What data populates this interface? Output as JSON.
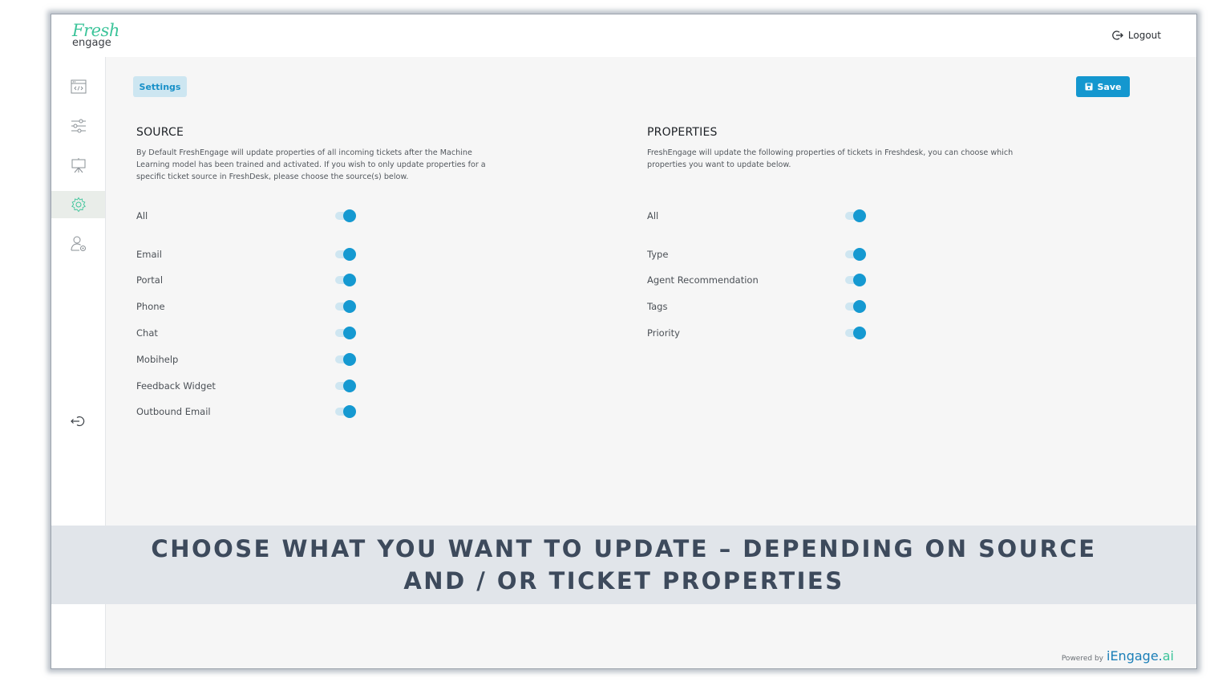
{
  "app": {
    "logo_top": "Fresh",
    "logo_bottom": "engage",
    "logout_label": "Logout"
  },
  "sidebar": {
    "items": [
      {
        "icon": "code-window-icon",
        "active": false
      },
      {
        "icon": "sliders-icon",
        "active": false
      },
      {
        "icon": "presentation-board-icon",
        "active": false
      },
      {
        "icon": "gear-icon",
        "active": true
      },
      {
        "icon": "user-settings-icon",
        "active": false
      },
      {
        "icon": "sign-out-icon",
        "active": false
      }
    ]
  },
  "toolbar": {
    "breadcrumb": "Settings",
    "save_label": "Save"
  },
  "source": {
    "title": "SOURCE",
    "description": "By Default FreshEngage will update properties of all incoming tickets after the Machine Learning model has been trained and activated. If you wish to only update properties for a specific ticket source in FreshDesk, please choose the source(s) below.",
    "all_label": "All",
    "all_on": true,
    "items": [
      {
        "label": "Email",
        "on": true
      },
      {
        "label": "Portal",
        "on": true
      },
      {
        "label": "Phone",
        "on": true
      },
      {
        "label": "Chat",
        "on": true
      },
      {
        "label": "Mobihelp",
        "on": true
      },
      {
        "label": "Feedback Widget",
        "on": true
      },
      {
        "label": "Outbound Email",
        "on": true
      }
    ]
  },
  "properties": {
    "title": "PROPERTIES",
    "description": "FreshEngage will update the following properties of tickets in Freshdesk, you can choose which properties you want to update below.",
    "all_label": "All",
    "all_on": true,
    "items": [
      {
        "label": "Type",
        "on": true
      },
      {
        "label": "Agent Recommendation",
        "on": true
      },
      {
        "label": "Tags",
        "on": true
      },
      {
        "label": "Priority",
        "on": true
      }
    ]
  },
  "banner": {
    "text": "CHOOSE WHAT YOU WANT TO UPDATE – DEPENDING ON SOURCE AND / OR TICKET PROPERTIES"
  },
  "footer": {
    "powered_by": "Powered by",
    "brand_main": "iEngage.",
    "brand_suffix": "ai"
  },
  "colors": {
    "accent": "#1497cf",
    "brand_green": "#3cc49a",
    "banner_text": "#3d4a5c"
  }
}
